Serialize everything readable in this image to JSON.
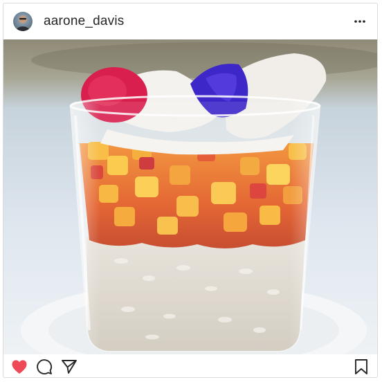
{
  "post": {
    "username": "aarone_davis",
    "more_icon": "more-horizontal-icon",
    "image_subject": "mango-rice-pudding-dessert",
    "actions": {
      "like_icon": "heart-filled-icon",
      "comment_icon": "comment-bubble-icon",
      "share_icon": "paper-plane-icon",
      "save_icon": "bookmark-icon"
    },
    "colors": {
      "like": "#ed4956",
      "text": "#262626",
      "border": "#dbdbdb"
    }
  }
}
